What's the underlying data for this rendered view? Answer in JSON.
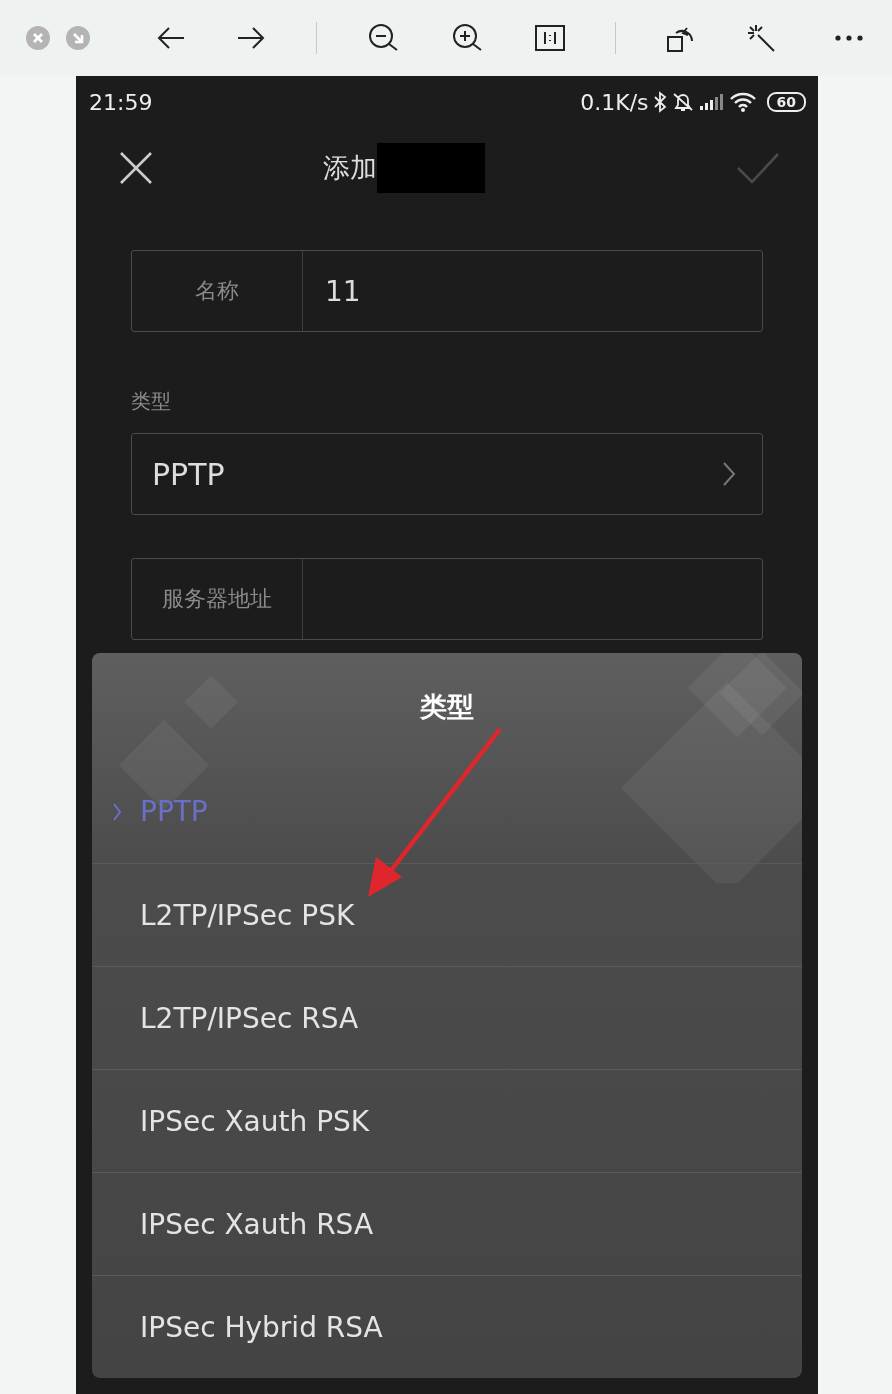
{
  "status_bar": {
    "time": "21:59",
    "net_speed": "0.1K/s",
    "battery": "60"
  },
  "header": {
    "title": "添加",
    "confirm_enabled": false
  },
  "form": {
    "name_field": {
      "label": "名称",
      "value": "11"
    },
    "type_label": "类型",
    "type_selector": {
      "value": "PPTP"
    },
    "server_field": {
      "label": "服务器地址"
    }
  },
  "type_dialog": {
    "title": "类型",
    "options": [
      {
        "label": "PPTP",
        "selected": true
      },
      {
        "label": "L2TP/IPSec PSK",
        "selected": false
      },
      {
        "label": "L2TP/IPSec RSA",
        "selected": false
      },
      {
        "label": "IPSec Xauth PSK",
        "selected": false
      },
      {
        "label": "IPSec Xauth RSA",
        "selected": false
      },
      {
        "label": "IPSec Hybrid RSA",
        "selected": false
      }
    ]
  }
}
